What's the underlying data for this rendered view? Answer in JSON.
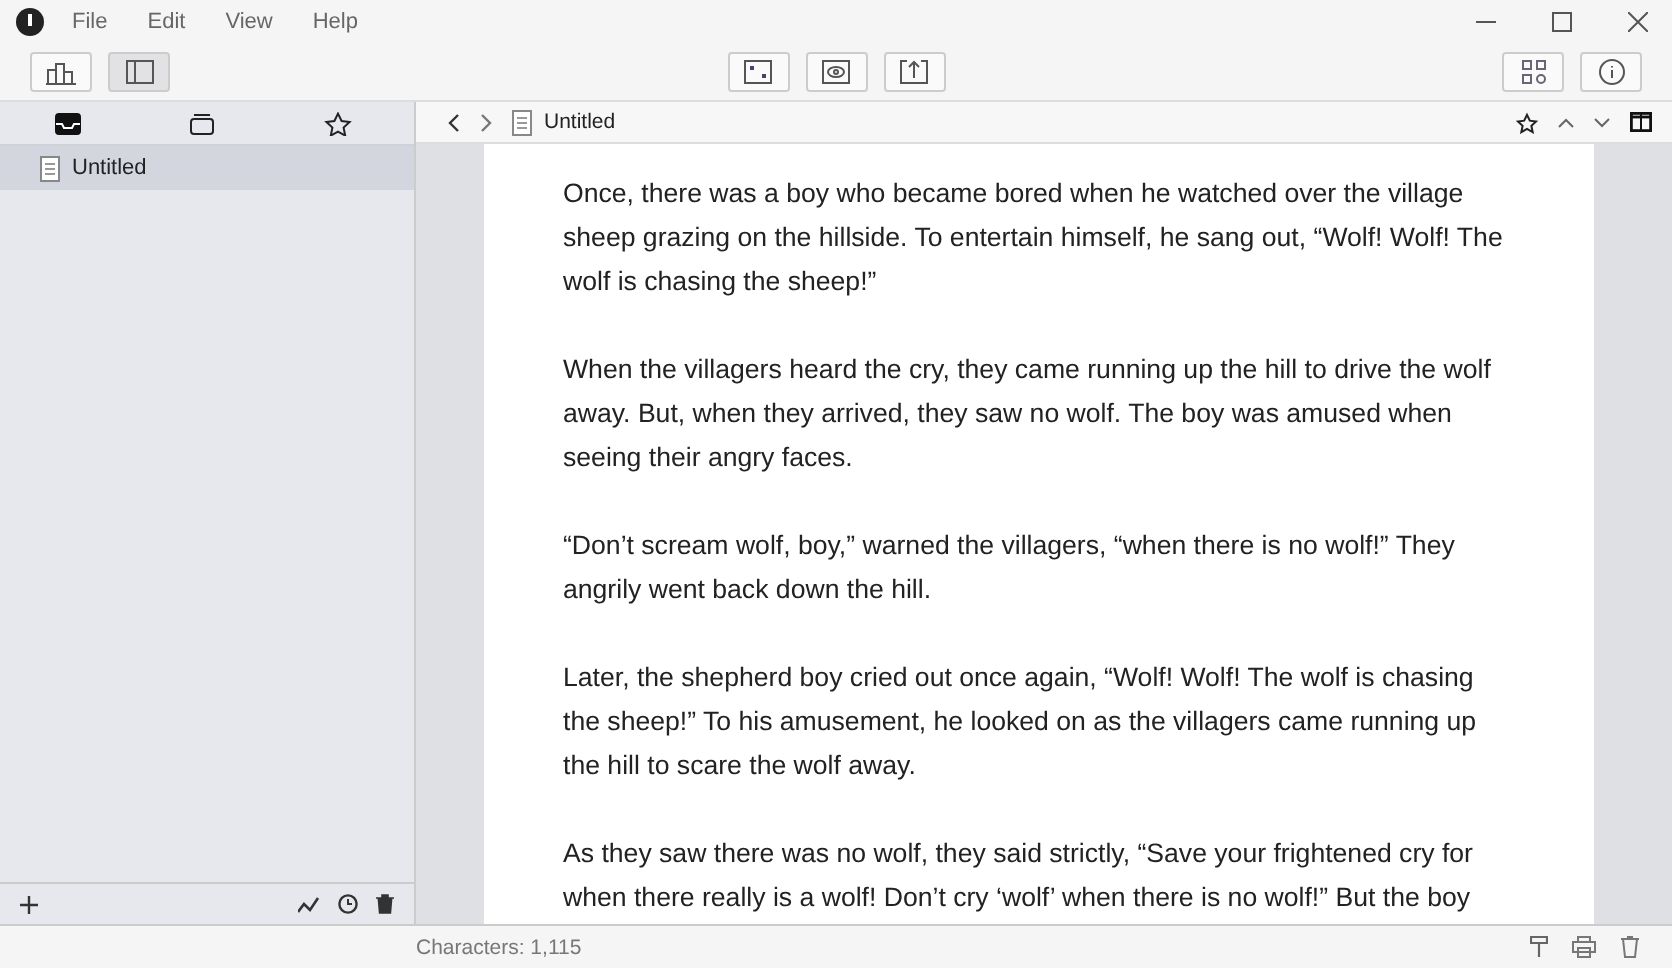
{
  "menu": [
    "File",
    "Edit",
    "View",
    "Help"
  ],
  "toolbar": {
    "left": [
      {
        "kind": "stats",
        "pressed": false
      },
      {
        "kind": "sidebar",
        "pressed": true
      }
    ],
    "center": [
      {
        "kind": "focus",
        "pressed": false
      },
      {
        "kind": "preview",
        "pressed": false
      },
      {
        "kind": "export",
        "pressed": false
      }
    ],
    "right": [
      {
        "kind": "grid",
        "pressed": false
      },
      {
        "kind": "info",
        "pressed": false
      }
    ]
  },
  "sidebar": {
    "tabs": [
      {
        "kind": "inbox",
        "selected": true
      },
      {
        "kind": "archive",
        "selected": false
      },
      {
        "kind": "star",
        "selected": false
      }
    ],
    "items": [
      {
        "title": "Untitled",
        "selected": true
      }
    ]
  },
  "editor_header": {
    "title": "Untitled"
  },
  "paragraphs": [
    "Once, there was a boy who became bored when he watched over the village sheep grazing on the hillside. To entertain himself, he sang out, “Wolf! Wolf! The wolf is chasing the sheep!”",
    "When the villagers heard the cry, they came running up the hill to drive the wolf away. But, when they arrived, they saw no wolf. The boy was amused when seeing their angry faces.",
    "“Don’t scream wolf, boy,” warned the villagers, “when there is no wolf!” They angrily went back down the hill.",
    "Later, the shepherd boy cried out once again, “Wolf! Wolf! The wolf is chasing the sheep!” To his amusement, he looked on as the villagers came running up the hill to scare the wolf away.",
    "As they saw there was no wolf, they said strictly, “Save your frightened cry for when there really is a wolf! Don’t cry ‘wolf’ when there is no wolf!” But the boy"
  ],
  "status_bar": {
    "characters": "Characters: 1,115"
  }
}
